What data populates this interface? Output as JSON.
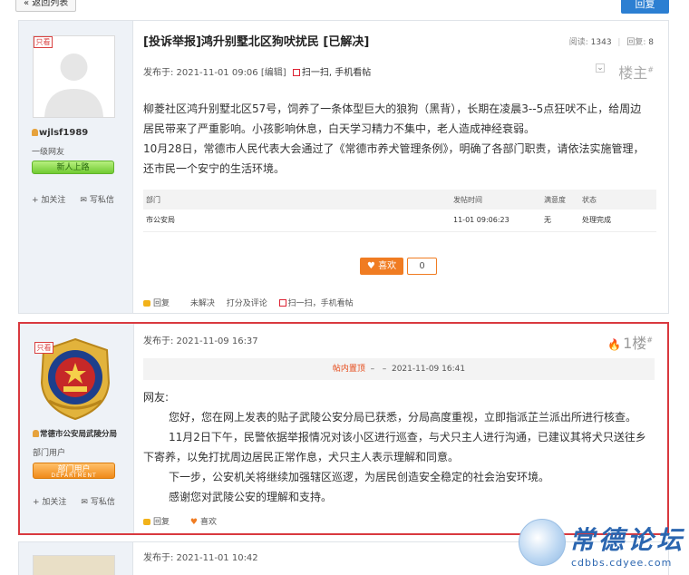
{
  "toolbar": {
    "back_label": "« 返回列表",
    "reply_label": "回复"
  },
  "thread": {
    "title": "[投诉举报]鸿升别墅北区狗吠扰民 [已解决]",
    "views_label": "阅读:",
    "views": "1343",
    "replies_label": "回复:",
    "replies": "8"
  },
  "posts": [
    {
      "badge": "只看",
      "username": "wjlsf1989",
      "group": "一级网友",
      "level": "新人上路",
      "follow": "加关注",
      "message": "写私信",
      "posted_at": "发布于: 2021-11-01 09:06",
      "edit": "[编辑]",
      "scan": "扫一扫, 手机看帖",
      "floor": "楼主",
      "paragraphs": [
        "柳菱社区鸿升别墅北区57号，饲养了一条体型巨大的狼狗（黑背），长期在凌晨3--5点狂吠不止，给周边",
        "居民带来了严重影响。小孩影响休息，白天学习精力不集中，老人造成神经衰弱。",
        "10月28日，常德市人民代表大会通过了《常德市养犬管理条例》，明确了各部门职责，请依法实施管理，",
        "还市民一个安宁的生活环境。"
      ],
      "table": {
        "headers": [
          "部门",
          "发帖时间",
          "满意度",
          "状态"
        ],
        "row": [
          "市公安局",
          "11-01 09:06:23",
          "无",
          "处理完成"
        ]
      },
      "like_label": "喜欢",
      "like_count": "0",
      "footer": [
        "回复",
        "未解决",
        "打分及评论",
        "扫一扫，手机看帖"
      ]
    },
    {
      "badge": "只看",
      "username": "常德市公安局武陵分局",
      "group": "部门用户",
      "level": "部门用户",
      "level_sub": "DEPARTMENT",
      "follow": "加关注",
      "message": "写私信",
      "posted_at": "发布于: 2021-11-09 16:37",
      "floor": "1楼",
      "sticky_label": "帖内置顶",
      "sticky_sep": "–",
      "sticky_sep2": "–",
      "sticky_time": "2021-11-09 16:41",
      "greeting": "网友:",
      "paragraphs": [
        "您好，您在网上发表的贴子武陵公安分局已获悉，分局高度重视，立即指派芷兰派出所进行核查。",
        "11月2日下午，民警依据举报情况对该小区进行巡查，与犬只主人进行沟通，已建议其将犬只送往乡",
        "下寄养，以免打扰周边居民正常作息，犬只主人表示理解和同意。",
        "下一步，公安机关将继续加强辖区巡逻，为居民创造安全稳定的社会治安环境。",
        "感谢您对武陵公安的理解和支持。"
      ],
      "footer_reply": "回复",
      "footer_like": "喜欢"
    },
    {
      "posted_at": "发布于: 2021-11-01 10:42"
    }
  ],
  "watermark": {
    "title": "常德论坛",
    "url": "cdbbs.cdyee.com"
  }
}
